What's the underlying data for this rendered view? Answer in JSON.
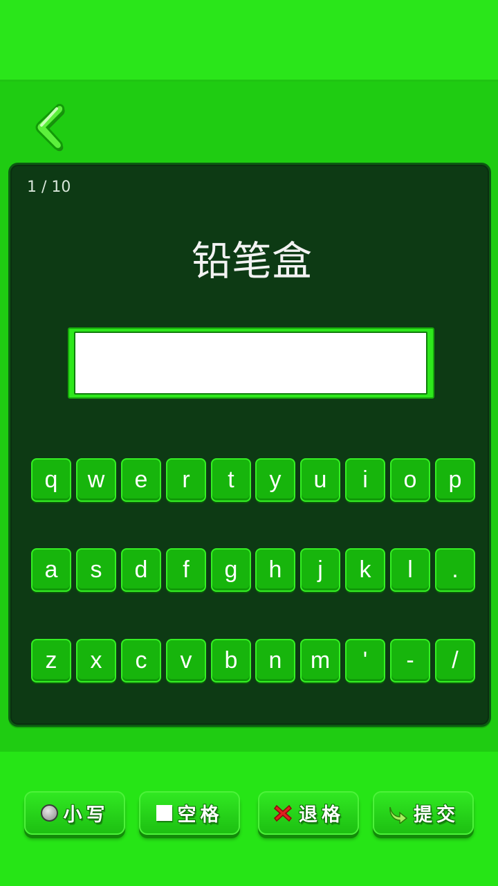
{
  "progress": {
    "text": "1 / 10"
  },
  "question": {
    "word": "铅笔盒"
  },
  "answer": {
    "value": ""
  },
  "keyboard": {
    "rows": [
      [
        "q",
        "w",
        "e",
        "r",
        "t",
        "y",
        "u",
        "i",
        "o",
        "p"
      ],
      [
        "a",
        "s",
        "d",
        "f",
        "g",
        "h",
        "j",
        "k",
        "l",
        "."
      ],
      [
        "z",
        "x",
        "c",
        "v",
        "b",
        "n",
        "m",
        "'",
        "-",
        "/"
      ]
    ]
  },
  "actions": {
    "lowercase_label": "小写",
    "space_label": "空格",
    "backspace_label": "退格",
    "submit_label": "提交"
  },
  "colors": {
    "board_background": "#0d3a14",
    "key_background": "#17b50c",
    "page_background": "#22d614"
  },
  "icons": [
    "back-arrow-icon",
    "radio-icon",
    "square-icon",
    "x-icon",
    "arrow-icon"
  ]
}
